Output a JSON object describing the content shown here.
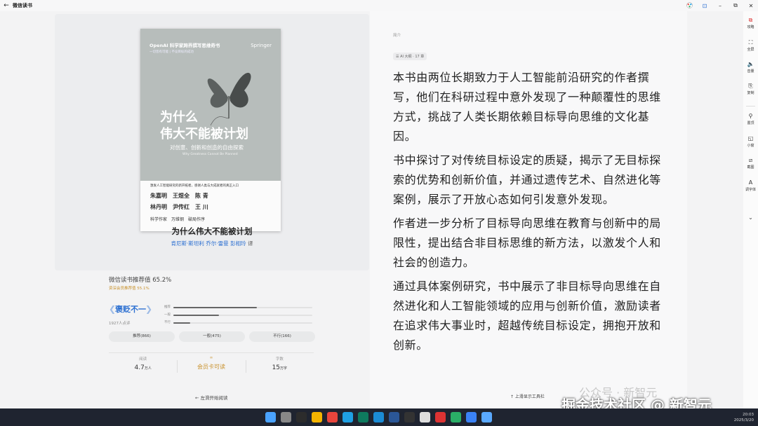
{
  "window": {
    "title": "微信读书",
    "back_icon": "←",
    "buttons": [
      "–",
      "⧉",
      "✕"
    ],
    "ext_icons": [
      "⊡"
    ]
  },
  "book": {
    "cover": {
      "series": "OpenAI 科学家跨界撰写思维奇书",
      "tagline": "一切皆有可能 | 不设目标的成功",
      "publisher": "Springer",
      "title_line1": "为什么",
      "title_line2": "伟大不能被计划",
      "subtitle": "对创意、创新和创造的自由探索",
      "english": "Why Greatness Cannot Be Planned",
      "recommend": "激发人工智能研究的新开拓者，感谢人类与大成就者的真正入口",
      "names_row1": "朱嘉明　王煜全　陈 青",
      "names_row2": "林丹明　尹传红　王 川",
      "footer": "科学作家　万维钢　破局作序"
    },
    "title": "为什么伟大不能被计划",
    "authors": "肯尼斯·斯坦利 乔尔·雷曼",
    "translator": "彭相玲",
    "translator_suffix": "译"
  },
  "rating": {
    "label": "微信读书推荐值 65.2%",
    "member_label": "资深会员推荐值 55.1%",
    "verdict": "褒贬不一",
    "count_text": "1927人点评",
    "bars": [
      {
        "label": "推荐",
        "value": 0.6
      },
      {
        "label": "一般",
        "value": 0.33
      },
      {
        "label": "不行",
        "value": 0.12
      }
    ],
    "buttons": [
      "推荐(866)",
      "一般(475)",
      "不行(166)"
    ]
  },
  "stats": [
    {
      "label": "阅读",
      "value": "4.7",
      "unit": "万人"
    },
    {
      "label": "∞",
      "value": "会员卡可读",
      "unit": ""
    },
    {
      "label": "字数",
      "value": "15",
      "unit": "万字"
    }
  ],
  "hints": {
    "left": "← 左滑开始阅读",
    "right": "↑ 上滑显示工具栏"
  },
  "intro": {
    "label": "简介",
    "chip": "☰ AI 大纲 · 17 章",
    "paragraphs": [
      "本书由两位长期致力于人工智能前沿研究的作者撰写，他们在科研过程中意外发现了一种颠覆性的思维方式，挑战了人类长期依赖目标导向思维的文化基因。",
      "书中探讨了对传统目标设定的质疑，揭示了无目标探索的优势和创新价值，并通过遗传艺术、自然进化等案例，展示了开放心态如何引发意外发现。",
      "作者进一步分析了目标导向思维在教育与创新中的局限性，提出结合非目标思维的新方法，以激发个人和社会的创造力。",
      "通过具体案例研究，书中展示了非目标导向思维在自然进化和人工智能领域的应用与创新价值，激励读者在追求伟大事业时，超越传统目标设定，拥抱开放和创新。"
    ]
  },
  "toolbar": [
    {
      "icon": "⧉",
      "label": "攻略"
    },
    {
      "icon": "⛶",
      "label": "全屏"
    },
    {
      "icon": "🔈",
      "label": "音量"
    },
    {
      "icon": "⎘",
      "label": "复制"
    },
    {
      "icon": "⚲",
      "label": "置顶"
    },
    {
      "icon": "◱",
      "label": "小窗"
    },
    {
      "icon": "⧄",
      "label": "截图"
    },
    {
      "icon": "A",
      "label": "调字体"
    }
  ],
  "watermark": {
    "line1": "公众号 · 新智元",
    "line2": "掘金技术社区 @ 新智元"
  },
  "taskbar": {
    "time": "20:03",
    "date": "2025/3/20",
    "icon_colors": [
      "#4aa3ff",
      "#888",
      "#2c2c2c",
      "#f4b400",
      "#e8453c",
      "#1fa0e3",
      "#0e7a5e",
      "#1b8bd4",
      "#2b5797",
      "#333",
      "#ddd",
      "#d33",
      "#2aae67",
      "#3b82f6",
      "#5aa9ff"
    ]
  }
}
